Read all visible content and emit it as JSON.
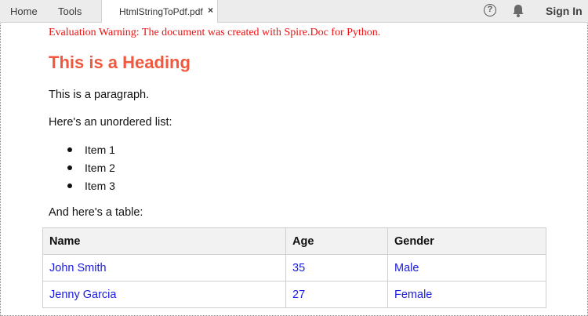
{
  "toolbar": {
    "menu": [
      "Home",
      "Tools"
    ],
    "tab_title": "HtmlStringToPdf.pdf",
    "tab_close": "×",
    "help_symbol": "?",
    "sign_in": "Sign In"
  },
  "document": {
    "warning": "Evaluation Warning: The document was created with Spire.Doc for Python.",
    "heading": "This is a Heading",
    "paragraph": "This is a paragraph.",
    "list_intro": "Here's an unordered list:",
    "list_items": [
      "Item 1",
      "Item 2",
      "Item 3"
    ],
    "table_intro": "And here's a table:",
    "table": {
      "headers": [
        "Name",
        "Age",
        "Gender"
      ],
      "rows": [
        [
          "John Smith",
          "35",
          "Male"
        ],
        [
          "Jenny Garcia",
          "27",
          "Female"
        ]
      ]
    }
  },
  "colors": {
    "warning": "#ee1111",
    "heading": "#f0593e",
    "cell_text": "#1a1adf"
  }
}
